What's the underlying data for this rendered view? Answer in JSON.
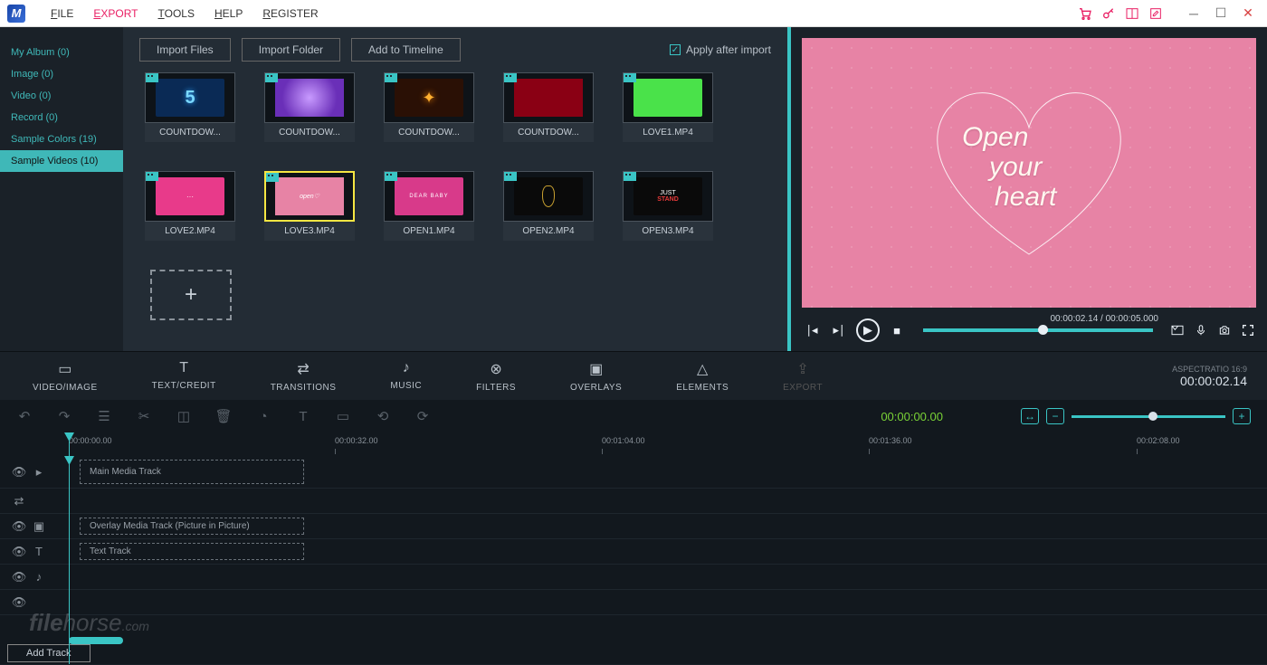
{
  "menu": {
    "file": "FILE",
    "export": "EXPORT",
    "tools": "TOOLS",
    "help": "HELP",
    "register": "REGISTER"
  },
  "sidebar": [
    {
      "label": "My Album (0)"
    },
    {
      "label": "Image (0)"
    },
    {
      "label": "Video (0)"
    },
    {
      "label": "Record (0)"
    },
    {
      "label": "Sample Colors (19)"
    },
    {
      "label": "Sample Videos (10)"
    }
  ],
  "toolbar": {
    "import_files": "Import Files",
    "import_folder": "Import Folder",
    "add_timeline": "Add to Timeline",
    "apply_after": "Apply after import"
  },
  "media": [
    {
      "label": "COUNTDOW...",
      "bg": "#0a2a55",
      "fx": "num5"
    },
    {
      "label": "COUNTDOW...",
      "bg": "#6a2fb8",
      "fx": "sparkle"
    },
    {
      "label": "COUNTDOW...",
      "bg": "#2a1005",
      "fx": "fire"
    },
    {
      "label": "COUNTDOW...",
      "bg": "#a00018",
      "fx": "red"
    },
    {
      "label": "LOVE1.MP4",
      "bg": "#4ae24a",
      "fx": "plain"
    },
    {
      "label": "LOVE2.MP4",
      "bg": "#e83a8a",
      "fx": "love2"
    },
    {
      "label": "LOVE3.MP4",
      "bg": "#e783a5",
      "fx": "love3",
      "selected": true
    },
    {
      "label": "OPEN1.MP4",
      "bg": "#d83a8a",
      "fx": "open1"
    },
    {
      "label": "OPEN2.MP4",
      "bg": "#0a0a0a",
      "fx": "lamp"
    },
    {
      "label": "OPEN3.MP4",
      "bg": "#0a0a0a",
      "fx": "stand"
    }
  ],
  "preview": {
    "heart_l1": "Open",
    "heart_l2": "your",
    "heart_l3": "heart",
    "time": "00:00:02.14 / 00:00:05.000"
  },
  "tabs": [
    {
      "label": "VIDEO/IMAGE",
      "icon": "▭"
    },
    {
      "label": "TEXT/CREDIT",
      "icon": "T"
    },
    {
      "label": "TRANSITIONS",
      "icon": "⇄"
    },
    {
      "label": "MUSIC",
      "icon": "♪"
    },
    {
      "label": "FILTERS",
      "icon": "⊗"
    },
    {
      "label": "OVERLAYS",
      "icon": "▣"
    },
    {
      "label": "ELEMENTS",
      "icon": "△"
    },
    {
      "label": "EXPORT",
      "icon": "⇪",
      "disabled": true
    }
  ],
  "aspect": {
    "label": "ASPECTRATIO 16:9",
    "tc": "00:00:02.14"
  },
  "editbar_time": "00:00:00.00",
  "ruler": [
    "00:00:00.00",
    "00:00:32.00",
    "00:01:04.00",
    "00:01:36.00",
    "00:02:08.00"
  ],
  "tracks": {
    "main": "Main Media Track",
    "overlay": "Overlay Media Track (Picture in Picture)",
    "text": "Text Track"
  },
  "add_track": "Add Track",
  "watermark": "filehorse.com"
}
